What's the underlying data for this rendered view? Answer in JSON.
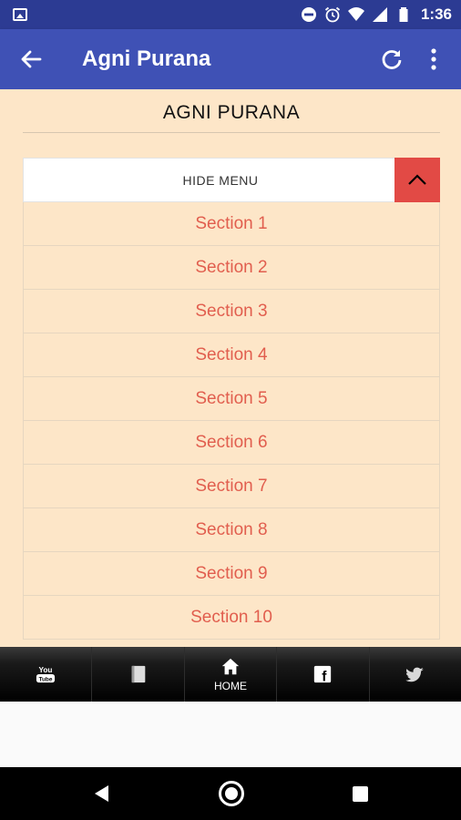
{
  "status_bar": {
    "time": "1:36"
  },
  "app_bar": {
    "title": "Agni Purana"
  },
  "page": {
    "heading": "AGNI PURANA"
  },
  "menu": {
    "toggle_label": "HIDE MENU",
    "items": [
      {
        "label": "Section 1"
      },
      {
        "label": "Section 2"
      },
      {
        "label": "Section 3"
      },
      {
        "label": "Section 4"
      },
      {
        "label": "Section 5"
      },
      {
        "label": "Section 6"
      },
      {
        "label": "Section 7"
      },
      {
        "label": "Section 8"
      },
      {
        "label": "Section 9"
      },
      {
        "label": "Section 10"
      }
    ]
  },
  "bottom_nav": {
    "items": [
      {
        "icon": "youtube-icon",
        "icon_text": "You Tube",
        "label": ""
      },
      {
        "icon": "book-icon",
        "label": ""
      },
      {
        "icon": "home-icon",
        "label": "HOME"
      },
      {
        "icon": "facebook-icon",
        "icon_text": "f",
        "label": ""
      },
      {
        "icon": "twitter-icon",
        "label": ""
      }
    ]
  },
  "colors": {
    "status_bar": "#2c3b93",
    "app_bar": "#3f51b5",
    "content_bg": "#fde6c8",
    "accent": "#e24a45",
    "section_text": "#e15e4e"
  }
}
